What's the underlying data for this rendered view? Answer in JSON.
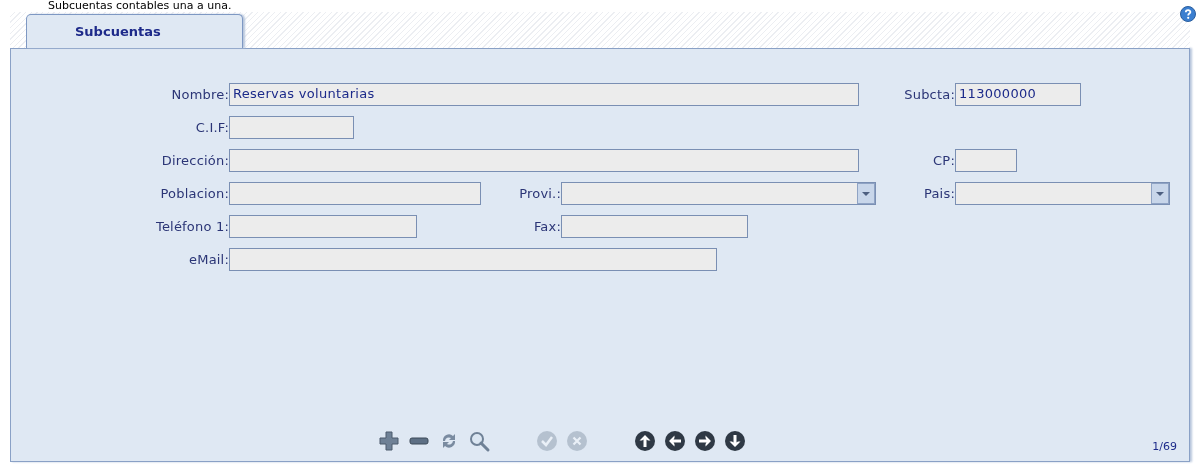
{
  "page_heading": "Subcuentas contables una a una.",
  "tabs": [
    {
      "label": "Subcuentas",
      "selected": true
    }
  ],
  "fields": [
    {
      "label": "Nombre:",
      "kind": "text",
      "value": "Reservas voluntarias"
    },
    {
      "label": "Subcta:",
      "kind": "text",
      "value": "113000000"
    },
    {
      "label": "C.I.F:",
      "kind": "text"
    },
    {
      "label": "Dirección:",
      "kind": "text"
    },
    {
      "label": "CP:",
      "kind": "text"
    },
    {
      "label": "Poblacion:",
      "kind": "text"
    },
    {
      "label": "Provi.:",
      "kind": "select"
    },
    {
      "label": "Pais:",
      "kind": "select"
    },
    {
      "label": "Teléfono 1:",
      "kind": "text"
    },
    {
      "label": "Fax:",
      "kind": "text"
    },
    {
      "label": "eMail:",
      "kind": "text"
    }
  ],
  "toolbar": [
    {
      "kind": "add",
      "disabled": false
    },
    {
      "kind": "remove",
      "disabled": false
    },
    {
      "kind": "refresh",
      "disabled": false
    },
    {
      "kind": "search",
      "disabled": false
    },
    {
      "kind": "accept",
      "disabled": true
    },
    {
      "kind": "cancel",
      "disabled": true
    },
    {
      "kind": "up",
      "disabled": false
    },
    {
      "kind": "left",
      "disabled": false
    },
    {
      "kind": "right",
      "disabled": false
    },
    {
      "kind": "down",
      "disabled": false
    }
  ],
  "record_counter": "1/69"
}
